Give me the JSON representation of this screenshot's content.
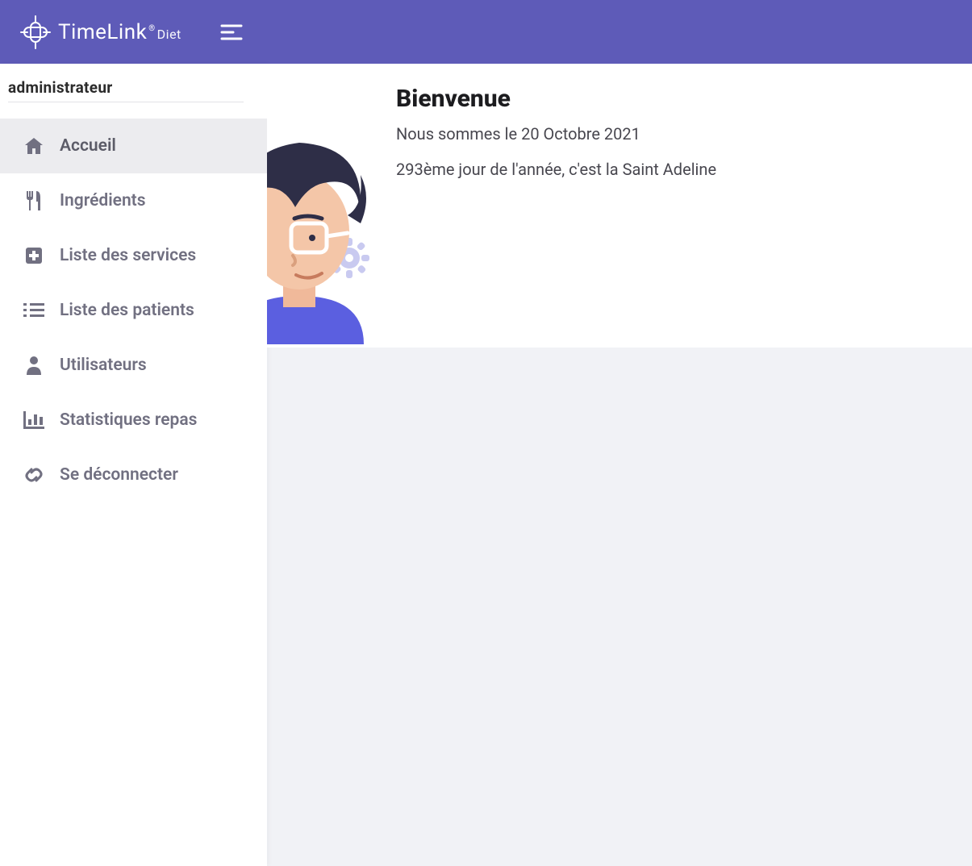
{
  "header": {
    "logo_main": "TimeLink",
    "logo_reg": "®",
    "logo_sub": "Diet"
  },
  "sidebar": {
    "section_label": "administrateur",
    "items": [
      {
        "label": "Accueil",
        "icon": "home-icon",
        "active": true
      },
      {
        "label": "Ingrédients",
        "icon": "utensils-icon",
        "active": false
      },
      {
        "label": "Liste des services",
        "icon": "hospital-icon",
        "active": false
      },
      {
        "label": "Liste des patients",
        "icon": "list-icon",
        "active": false
      },
      {
        "label": "Utilisateurs",
        "icon": "user-icon",
        "active": false
      },
      {
        "label": "Statistiques repas",
        "icon": "chart-icon",
        "active": false
      },
      {
        "label": "Se déconnecter",
        "icon": "link-icon",
        "active": false
      }
    ]
  },
  "welcome": {
    "title": "Bienvenue",
    "date_line": "Nous sommes le 20 Octobre 2021",
    "day_line": "293ème jour de l'année, c'est la Saint Adeline"
  },
  "colors": {
    "primary": "#5e5bb8",
    "sidebar_active_bg": "#ececef",
    "text_muted": "#717081"
  }
}
